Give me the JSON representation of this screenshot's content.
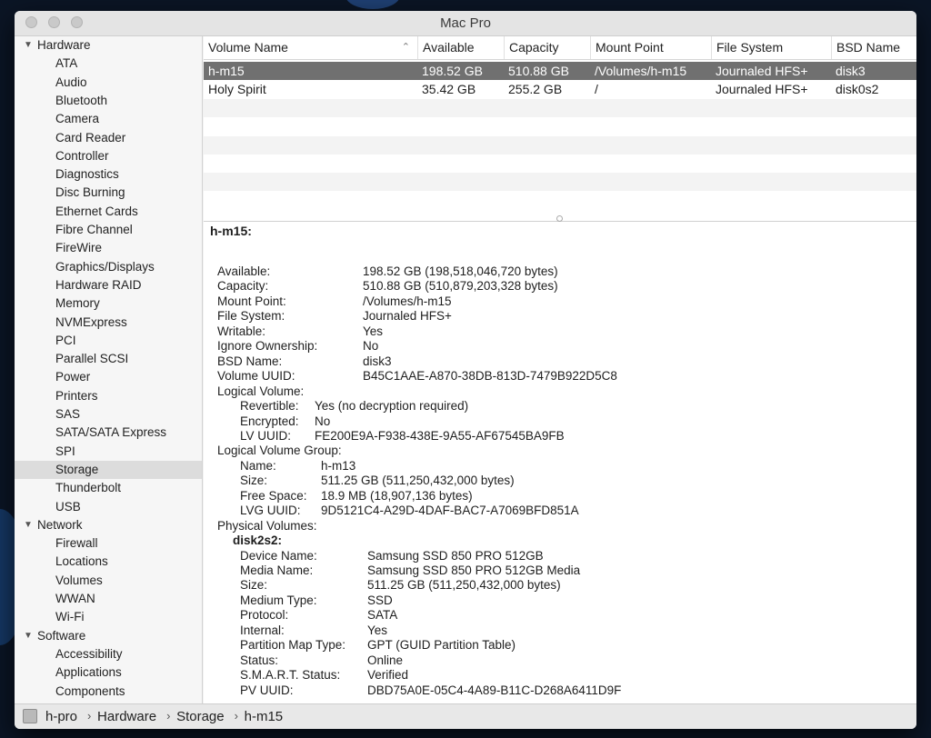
{
  "window": {
    "title": "Mac Pro"
  },
  "sidebar": {
    "sections": [
      {
        "label": "Hardware",
        "items": [
          "ATA",
          "Audio",
          "Bluetooth",
          "Camera",
          "Card Reader",
          "Controller",
          "Diagnostics",
          "Disc Burning",
          "Ethernet Cards",
          "Fibre Channel",
          "FireWire",
          "Graphics/Displays",
          "Hardware RAID",
          "Memory",
          "NVMExpress",
          "PCI",
          "Parallel SCSI",
          "Power",
          "Printers",
          "SAS",
          "SATA/SATA Express",
          "SPI",
          "Storage",
          "Thunderbolt",
          "USB"
        ]
      },
      {
        "label": "Network",
        "items": [
          "Firewall",
          "Locations",
          "Volumes",
          "WWAN",
          "Wi-Fi"
        ]
      },
      {
        "label": "Software",
        "items": [
          "Accessibility",
          "Applications",
          "Components"
        ]
      }
    ],
    "selected": "Storage"
  },
  "table": {
    "columns": [
      "Volume Name",
      "Available",
      "Capacity",
      "Mount Point",
      "File System",
      "BSD Name"
    ],
    "rows": [
      [
        "h-m15",
        "198.52 GB",
        "510.88 GB",
        "/Volumes/h-m15",
        "Journaled HFS+",
        "disk3"
      ],
      [
        "Holy Spirit",
        "35.42 GB",
        "255.2 GB",
        "/",
        "Journaled HFS+",
        "disk0s2"
      ]
    ],
    "selected_row": 0
  },
  "details": {
    "title": "h-m15:",
    "lines": [
      {
        "k": "Available:",
        "v": "198.52 GB (198,518,046,720 bytes)",
        "lvl": 0
      },
      {
        "k": "Capacity:",
        "v": "510.88 GB (510,879,203,328 bytes)",
        "lvl": 0
      },
      {
        "k": "Mount Point:",
        "v": "/Volumes/h-m15",
        "lvl": 0
      },
      {
        "k": "File System:",
        "v": "Journaled HFS+",
        "lvl": 0
      },
      {
        "k": "Writable:",
        "v": "Yes",
        "lvl": 0
      },
      {
        "k": "Ignore Ownership:",
        "v": "No",
        "lvl": 0
      },
      {
        "k": "BSD Name:",
        "v": "disk3",
        "lvl": 0
      },
      {
        "k": "Volume UUID:",
        "v": "B45C1AAE-A870-38DB-813D-7479B922D5C8",
        "lvl": 0
      },
      {
        "k": "Logical Volume:",
        "v": "",
        "lvl": 0
      },
      {
        "k": "Revertible:",
        "v": "Yes (no decryption required)",
        "lvl": 1
      },
      {
        "k": "Encrypted:",
        "v": "No",
        "lvl": 1
      },
      {
        "k": "LV UUID:",
        "v": "FE200E9A-F938-438E-9A55-AF67545BA9FB",
        "lvl": 1
      },
      {
        "k": "Logical Volume Group:",
        "v": "",
        "lvl": 0
      },
      {
        "k": "Name:",
        "v": "h-m13",
        "lvl": 2
      },
      {
        "k": "Size:",
        "v": "511.25 GB (511,250,432,000 bytes)",
        "lvl": 2
      },
      {
        "k": "Free Space:",
        "v": "18.9 MB (18,907,136 bytes)",
        "lvl": 2
      },
      {
        "k": "LVG UUID:",
        "v": "9D5121C4-A29D-4DAF-BAC7-A7069BFD851A",
        "lvl": 2
      },
      {
        "k": "Physical Volumes:",
        "v": "",
        "lvl": 0
      },
      {
        "k": "disk2s2:",
        "v": "",
        "lvl": 3
      },
      {
        "k": "Device Name:",
        "v": "Samsung SSD 850 PRO 512GB",
        "lvl": 4
      },
      {
        "k": "Media Name:",
        "v": "Samsung SSD 850 PRO 512GB Media",
        "lvl": 4
      },
      {
        "k": "Size:",
        "v": "511.25 GB (511,250,432,000 bytes)",
        "lvl": 4
      },
      {
        "k": "Medium Type:",
        "v": "SSD",
        "lvl": 4
      },
      {
        "k": "Protocol:",
        "v": "SATA",
        "lvl": 4
      },
      {
        "k": "Internal:",
        "v": "Yes",
        "lvl": 4
      },
      {
        "k": "Partition Map Type:",
        "v": "GPT (GUID Partition Table)",
        "lvl": 4
      },
      {
        "k": "Status:",
        "v": "Online",
        "lvl": 4
      },
      {
        "k": "S.M.A.R.T. Status:",
        "v": "Verified",
        "lvl": 4
      },
      {
        "k": "PV UUID:",
        "v": "DBD75A0E-05C4-4A89-B11C-D268A6411D9F",
        "lvl": 4
      }
    ]
  },
  "breadcrumb": [
    "h-pro",
    "Hardware",
    "Storage",
    "h-m15"
  ],
  "icons": {
    "sort": "sort-ascending-icon",
    "disclosure": "disclosure-triangle-icon",
    "computer": "hard-drive-icon"
  }
}
